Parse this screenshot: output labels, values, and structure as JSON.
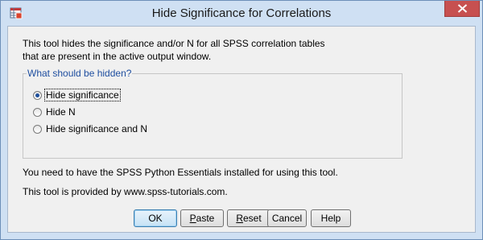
{
  "window": {
    "title": "Hide Significance for Correlations",
    "close_icon": "close-icon",
    "app_icon": "spss-table-icon"
  },
  "description": {
    "line1": "This tool hides the significance and/or N for all SPSS correlation tables",
    "line2": "that are present in the active output window."
  },
  "group": {
    "legend": "What should be hidden?",
    "options": [
      {
        "label": "Hide significance",
        "selected": true
      },
      {
        "label": "Hide N",
        "selected": false
      },
      {
        "label": "Hide significance and N",
        "selected": false
      }
    ]
  },
  "notes": {
    "requirement": "You need to have the SPSS Python Essentials installed for using this tool.",
    "provider": "This tool is provided by www.spss-tutorials.com."
  },
  "buttons": {
    "ok": "OK",
    "paste_first": "P",
    "paste_rest": "aste",
    "reset_first": "R",
    "reset_rest": "eset",
    "cancel": "Cancel",
    "help": "Help"
  },
  "colors": {
    "title_bar": "#cfe0f3",
    "close_button": "#c75050",
    "legend_text": "#1f4fa0",
    "dialog_background": "#f0f0f0"
  }
}
